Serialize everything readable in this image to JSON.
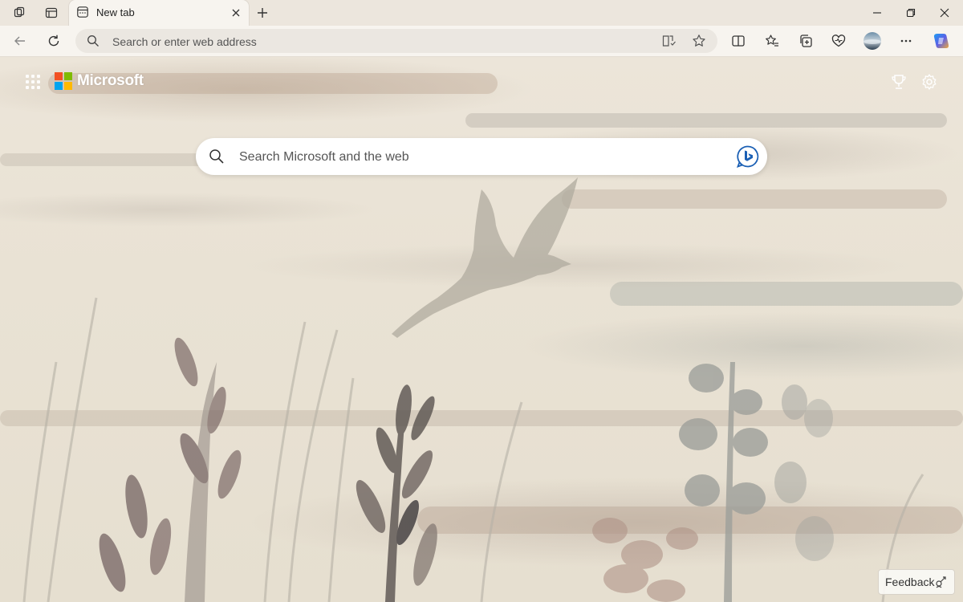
{
  "titlebar": {
    "tab": {
      "title": "New tab"
    },
    "icons": [
      "workspaces-icon",
      "tab-actions-icon",
      "new-tab-icon",
      "close-tab-icon"
    ],
    "window_controls": [
      "minimize-icon",
      "restore-icon",
      "close-window-icon"
    ]
  },
  "toolbar": {
    "address_placeholder": "Search or enter web address",
    "icons": [
      "back-icon",
      "refresh-icon",
      "immersive-reader-icon",
      "favorite-star-icon",
      "split-screen-icon",
      "favorites-icon",
      "collections-icon",
      "browser-essentials-icon",
      "profile-avatar",
      "more-icon",
      "copilot-icon"
    ]
  },
  "page": {
    "brand": "Microsoft",
    "brand_colors": [
      "#f25022",
      "#7fba00",
      "#00a4ef",
      "#ffb900"
    ],
    "search_placeholder": "Search Microsoft and the web",
    "feedback_label": "Feedback"
  },
  "colors": {
    "accent": "#0f6cbd",
    "chrome_bg": "#f7f4ef",
    "background": "#ece5d9"
  }
}
